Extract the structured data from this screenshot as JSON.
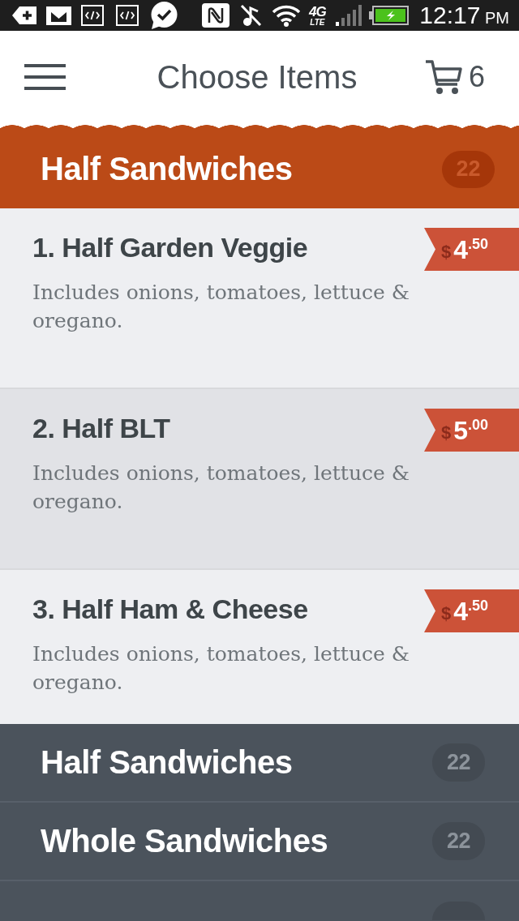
{
  "status_bar": {
    "network": {
      "generation": "4G",
      "type": "LTE"
    },
    "time": "12:17",
    "period": "PM"
  },
  "header": {
    "title": "Choose Items",
    "cart_count": "6"
  },
  "section": {
    "title": "Half Sandwiches",
    "count": "22"
  },
  "items": [
    {
      "name": "1. Half Garden Veggie",
      "description": "Includes onions, tomatoes, lettuce & oregano.",
      "price": {
        "currency": "$",
        "dollars": "4",
        "cents": ".50"
      },
      "selected": false
    },
    {
      "name": "2. Half BLT",
      "description": "Includes onions, tomatoes, lettuce & oregano.",
      "price": {
        "currency": "$",
        "dollars": "5",
        "cents": ".00"
      },
      "selected": true
    },
    {
      "name": "3. Half Ham & Cheese",
      "description": "Includes onions, tomatoes, lettuce & oregano.",
      "price": {
        "currency": "$",
        "dollars": "4",
        "cents": ".50"
      },
      "selected": false
    }
  ],
  "categories": [
    {
      "kind": "row",
      "label": "Half Sandwiches",
      "count": "22"
    },
    {
      "kind": "row",
      "label": "Whole Sandwiches",
      "count": "22"
    },
    {
      "kind": "clipped"
    }
  ]
}
